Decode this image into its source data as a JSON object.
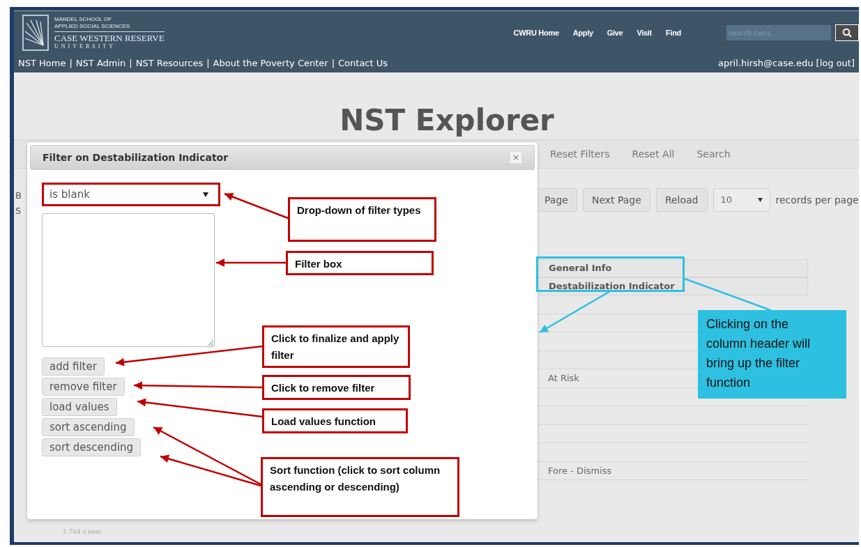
{
  "header": {
    "logo_lines": [
      "MANDEL SCHOOL OF",
      "APPLIED SOCIAL SCIENCES",
      "CASE WESTERN RESERVE",
      "UNIVERSITY"
    ],
    "top_links": [
      "CWRU Home",
      "Apply",
      "Give",
      "Visit",
      "Find"
    ],
    "search": {
      "placeholder": "search cwru.."
    },
    "nav_links": [
      "NST Home",
      "NST Admin",
      "NST Resources",
      "About the Poverty Center",
      "Contact Us"
    ],
    "nav_separator": "|",
    "user": "april.hirsh@case.edu",
    "logout": "[log out]"
  },
  "page": {
    "title": "NST Explorer",
    "toolbar": [
      "Reset Filters",
      "Reset All",
      "Search"
    ],
    "partial_texts": [
      "B",
      "S"
    ],
    "pagination": [
      "Page",
      "Next Page",
      "Reload"
    ],
    "per_page": {
      "value": "10",
      "label": "records per page"
    },
    "table": {
      "header_rows": [
        "General Info",
        "Destabilization Indicator"
      ],
      "rows": [
        {},
        {},
        {},
        {},
        {
          "cell": "At Risk"
        },
        {},
        {},
        {},
        {},
        {
          "cell": "Fore - Dismiss"
        }
      ]
    },
    "footer": "1.764 s exec"
  },
  "dialog": {
    "title": "Filter on Destabilization Indicator",
    "close": "×",
    "filter_type": {
      "value": "is blank"
    },
    "buttons": [
      "add filter",
      "remove filter",
      "load values",
      "sort ascending",
      "sort descending"
    ]
  },
  "annotations": [
    {
      "text": "Drop-down of filter types",
      "color": "#c00000"
    },
    {
      "text": "Filter box",
      "color": "#c00000"
    },
    {
      "text": "Click to finalize and apply filter",
      "color": "#c00000"
    },
    {
      "text": "Click to remove filter",
      "color": "#c00000"
    },
    {
      "text": "Load values function",
      "color": "#c00000"
    },
    {
      "text": "Sort function (click to sort column ascending or descending)",
      "color": "#c00000"
    },
    {
      "text": "Clicking on the column header will bring up the filter function",
      "color": "#2ec0e0"
    }
  ]
}
